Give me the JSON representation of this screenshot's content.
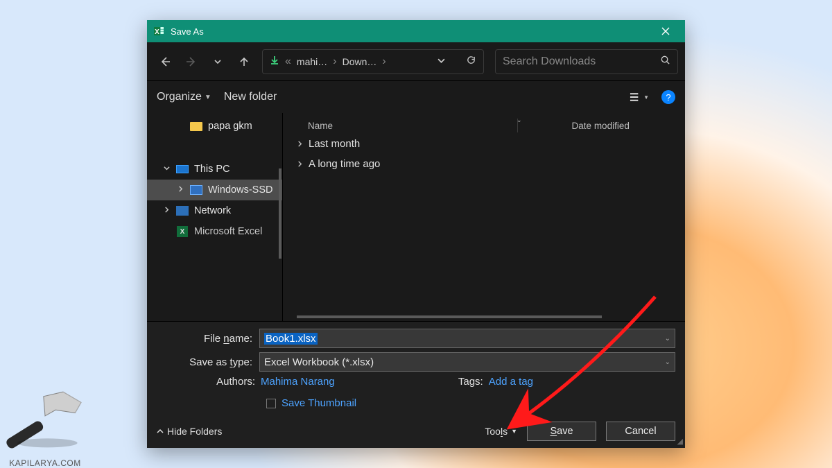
{
  "watermark_text": "KAPILARYA.COM",
  "titlebar": {
    "title": "Save As"
  },
  "nav": {
    "crumb1": "mahi…",
    "crumb2": "Down…",
    "search_placeholder": "Search Downloads"
  },
  "toolbar": {
    "organize": "Organize",
    "new_folder": "New folder"
  },
  "columns": {
    "name": "Name",
    "date": "Date modified"
  },
  "tree": {
    "papa": "papa gkm",
    "this_pc": "This PC",
    "win_ssd": "Windows-SSD",
    "network": "Network",
    "excel": "Microsoft Excel"
  },
  "groups": {
    "last_month": "Last month",
    "long_ago": "A long time ago"
  },
  "form": {
    "filename_label": "File name:",
    "filename_value": "Book1.xlsx",
    "type_label": "Save as type:",
    "type_value": "Excel Workbook (*.xlsx)",
    "authors_label": "Authors:",
    "authors_value": "Mahima Narang",
    "tags_label": "Tags:",
    "tags_value": "Add a tag",
    "save_thumb": "Save Thumbnail"
  },
  "footer": {
    "hide_folders": "Hide Folders",
    "tools": "Tools",
    "save": "Save",
    "cancel": "Cancel"
  }
}
